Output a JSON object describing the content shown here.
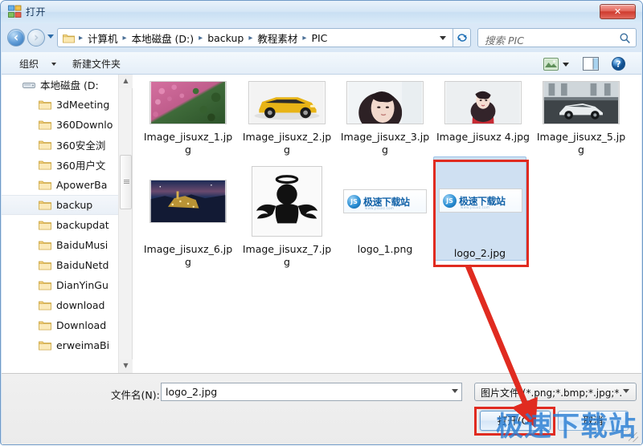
{
  "window": {
    "title": "打开",
    "title_icon": "open-folder-icon",
    "close_label": "✕"
  },
  "nav": {
    "back_icon": "back-arrow-icon",
    "forward_icon": "forward-arrow-icon",
    "history_caret": "chevron-down-icon",
    "refresh_icon": "refresh-icon",
    "breadcrumb": [
      "计算机",
      "本地磁盘 (D:)",
      "backup",
      "教程素材",
      "PIC"
    ],
    "breadcrumb_separator": "▸",
    "breadcrumb_caret": "chevron-down-icon"
  },
  "search": {
    "placeholder": "搜索 PIC",
    "icon": "search-icon"
  },
  "toolbar": {
    "organize_label": "组织",
    "organize_caret": "chevron-down-icon",
    "new_folder_label": "新建文件夹",
    "view_icon": "view-mode-icon",
    "view_caret": "chevron-down-icon",
    "preview_pane_icon": "preview-pane-icon",
    "help_icon": "help-icon"
  },
  "sidebar": {
    "root": {
      "label": "本地磁盘 (D:",
      "icon": "drive-icon"
    },
    "items": [
      {
        "label": "3dMeeting",
        "icon": "folder-icon",
        "selected": false
      },
      {
        "label": "360Downlo",
        "icon": "folder-icon",
        "selected": false
      },
      {
        "label": "360安全浏",
        "icon": "folder-icon",
        "selected": false
      },
      {
        "label": "360用户文",
        "icon": "folder-icon",
        "selected": false
      },
      {
        "label": "ApowerBa",
        "icon": "folder-icon",
        "selected": false
      },
      {
        "label": "backup",
        "icon": "folder-icon",
        "selected": true
      },
      {
        "label": "backupdat",
        "icon": "folder-icon",
        "selected": false
      },
      {
        "label": "BaiduMusi",
        "icon": "folder-icon",
        "selected": false
      },
      {
        "label": "BaiduNetd",
        "icon": "folder-icon",
        "selected": false
      },
      {
        "label": "DianYinGu",
        "icon": "folder-icon",
        "selected": false
      },
      {
        "label": "download",
        "icon": "folder-icon",
        "selected": false
      },
      {
        "label": "Download",
        "icon": "folder-icon",
        "selected": false
      },
      {
        "label": "erweimaBi",
        "icon": "folder-icon",
        "selected": false
      }
    ],
    "scroll_up_icon": "caret-up-icon",
    "scroll_down_icon": "caret-down-icon"
  },
  "files": [
    {
      "name": "Image_jisuxz_1.jpg",
      "thumb": "flowers-field-photo",
      "selected": false
    },
    {
      "name": "Image_jisuxz_2.jpg",
      "thumb": "yellow-suv-photo",
      "selected": false
    },
    {
      "name": "Image_jisuxz_3.jpg",
      "thumb": "portrait-woman-photo",
      "selected": false
    },
    {
      "name": "Image_jisuxz 4.jpg",
      "thumb": "portrait-red-dress-photo",
      "selected": false
    },
    {
      "name": "Image_jisuxz_5.jpg",
      "thumb": "white-sportscar-photo",
      "selected": false
    },
    {
      "name": "Image_jisuxz_6.jpg",
      "thumb": "night-town-photo",
      "selected": false
    },
    {
      "name": "Image_jisuxz_7.jpg",
      "thumb": "angel-silhouette-icon",
      "selected": false
    },
    {
      "name": "logo_1.png",
      "thumb": "jisu-download-logo",
      "selected": false
    },
    {
      "name": "logo_2.jpg",
      "thumb": "jisu-download-logo",
      "selected": true
    }
  ],
  "logo": {
    "badge": "JS",
    "text": "极速下载站",
    "subtext": "www.jisuxz.com"
  },
  "bottom": {
    "filename_label": "文件名(N):",
    "filename_value": "logo_2.jpg",
    "filename_caret": "chevron-down-icon",
    "filetype_value": "图片文件 (*.png;*.bmp;*.jpg;*.",
    "filetype_caret": "chevron-down-icon",
    "open_label": "打开(O)",
    "cancel_label": "取消",
    "resize_grip": "resize-grip-icon"
  },
  "annotations": {
    "highlight_color": "#e02b20",
    "arrow_icon": "red-arrow-annotation",
    "watermark_text": "极速下载站",
    "watermark_color": "#2b7fd4"
  }
}
